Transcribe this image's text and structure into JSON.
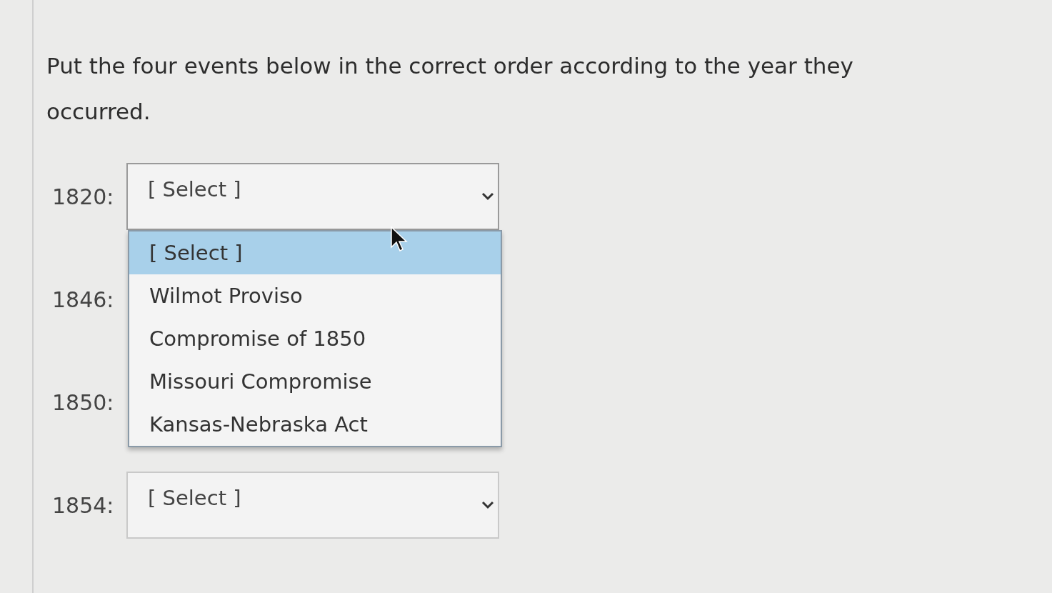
{
  "question": "Put the four events below in the correct order according to the year they occurred.",
  "rows": [
    {
      "year": "1820:",
      "value": "[ Select ]",
      "open": true,
      "options": [
        {
          "label": "[ Select ]",
          "selected": true
        },
        {
          "label": "Wilmot Proviso",
          "selected": false
        },
        {
          "label": "Compromise of 1850",
          "selected": false
        },
        {
          "label": "Missouri Compromise",
          "selected": false
        },
        {
          "label": "Kansas-Nebraska Act",
          "selected": false
        }
      ]
    },
    {
      "year": "1846:"
    },
    {
      "year": "1850:"
    },
    {
      "year": "1854:",
      "value": "[ Select ]",
      "open": false
    }
  ]
}
